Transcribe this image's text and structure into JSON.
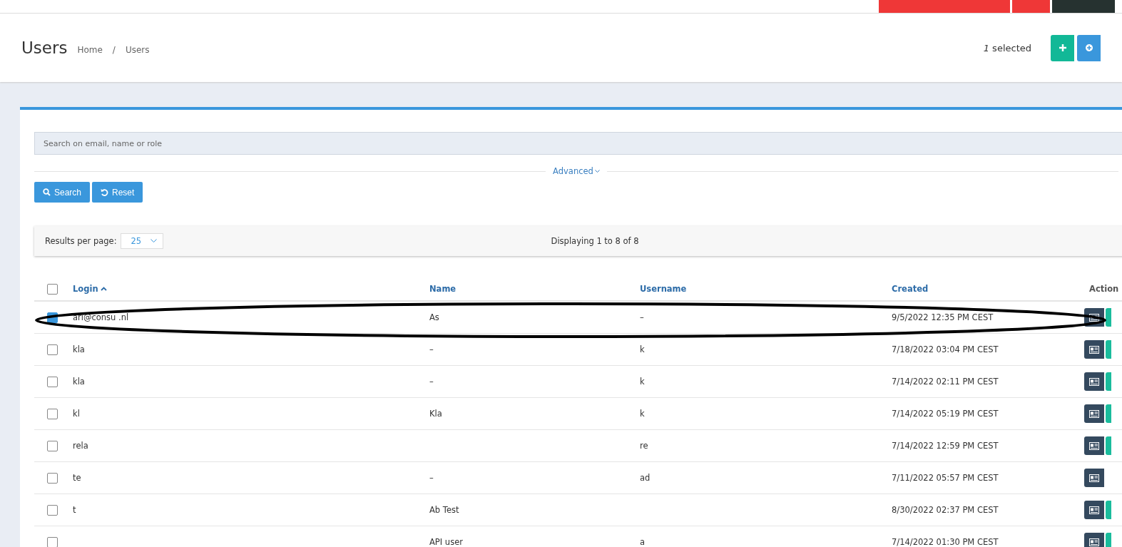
{
  "top_bar": {
    "buttons": [
      {
        "kind": "danger"
      },
      {
        "kind": "danger-icon"
      },
      {
        "kind": "dark"
      }
    ]
  },
  "header": {
    "title": "Users",
    "breadcrumb": [
      "Home",
      "Users"
    ],
    "breadcrumb_separator": "/",
    "selection": "*1* selected"
  },
  "filter": {
    "placeholder": "Search on email, name or role",
    "advanced": "Advanced",
    "buttons": [
      {
        "label": "Search",
        "kind": "search"
      },
      {
        "label": "Reset",
        "kind": "reset"
      }
    ]
  },
  "pager": {
    "label": "Results per page:",
    "per_page": "25",
    "summary": "Displaying 1 to 8 of 8"
  },
  "table": {
    "all_checked": false,
    "columns": [
      {
        "label": "Login",
        "sorted": true
      },
      {
        "label": "Name",
        "sorted": false
      },
      {
        "label": "Username",
        "sorted": false
      },
      {
        "label": "Created",
        "sorted": false
      },
      {
        "label": "Action"
      }
    ],
    "rows": [
      {
        "checked": true,
        "login": "ari@consu .nl",
        "name": "As",
        "username": "–",
        "created": "9/5/2022 12:35 PM CEST",
        "edit": true
      },
      {
        "checked": false,
        "login": "kla",
        "name": "–",
        "username": "k",
        "created": "7/18/2022 03:04 PM CEST",
        "edit": true
      },
      {
        "checked": false,
        "login": "kla",
        "name": "–",
        "username": "k",
        "created": "7/14/2022 02:11 PM CEST",
        "edit": true
      },
      {
        "checked": false,
        "login": "kl",
        "name": "Kla",
        "username": "k",
        "created": "7/14/2022 05:19 PM CEST",
        "edit": true
      },
      {
        "checked": false,
        "login": "rela",
        "username": "re",
        "created": "7/14/2022 12:59 PM CEST",
        "edit": true
      },
      {
        "checked": false,
        "login": "te",
        "name": "–",
        "username": "ad",
        "created": "7/11/2022 05:57 PM CEST",
        "edit": false
      },
      {
        "checked": false,
        "login": "t",
        "name": "Ab Test",
        "created": "8/30/2022 02:37 PM CEST",
        "edit": true
      },
      {
        "checked": false,
        "name": "API user",
        "username": "a",
        "created": "7/14/2022 01:30 PM CEST",
        "edit": true
      }
    ]
  }
}
